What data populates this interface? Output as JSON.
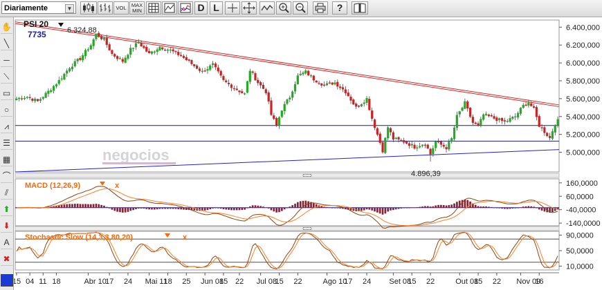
{
  "toolbar": {
    "period": "Diariamente",
    "vol_label": "VOL",
    "maxmin_label_1": "MAX",
    "maxmin_label_2": "MIN",
    "d_label": "D",
    "l_label": "L",
    "help_label": "?"
  },
  "icons": [
    "hand-icon",
    "line-icon",
    "hline-icon",
    "ray-icon",
    "rectangle-icon",
    "circle-icon",
    "fibonacci-icon",
    "fib-fan-icon",
    "fib-arc-icon",
    "channel-icon",
    "text-icon",
    "buy-arrow-icon",
    "sell-arrow-icon",
    "annotation-icon",
    "delete-icon"
  ],
  "colors": {
    "bull": "#22aa22",
    "bear": "#cc2222",
    "resistance": "#dd2222",
    "support": "#2222cc",
    "macd_line": "#8b4513",
    "macd_signal": "#ff7f27",
    "macd_hist": "#882233",
    "stoch_k": "#8b4513",
    "stoch_d": "#ff7f27",
    "title": "#ff6600"
  },
  "chart_data": [
    {
      "type": "candlestick",
      "title": "PSI 20",
      "last_value": "7735",
      "watermark": "negocios",
      "ylim": [
        4780,
        6480
      ],
      "y_ticks": [
        "6.400,000",
        "6.200,000",
        "6.000,000",
        "5.800,000",
        "5.600,000",
        "5.400,000",
        "5.200,000",
        "5.000,000"
      ],
      "y_tick_values": [
        6400,
        6200,
        6000,
        5800,
        5600,
        5400,
        5200,
        5000
      ],
      "x_labels": [
        "15",
        "04",
        "11",
        "18",
        "Abr 10",
        "17",
        "24",
        "Mai 11",
        "18",
        "25",
        "Jun 08",
        "15",
        "22",
        "Jul 08",
        "15",
        "22",
        "Ago 10",
        "17",
        "24",
        "Set 08",
        "15",
        "22",
        "Out 08",
        "15",
        "22",
        "Nov 09",
        "16"
      ],
      "x_label_bars": [
        0,
        5,
        10,
        15,
        27,
        35,
        42,
        50,
        57,
        64,
        71,
        78,
        84,
        92,
        99,
        106,
        117,
        125,
        132,
        142,
        149,
        156,
        167,
        174,
        181,
        190,
        197
      ],
      "n_bars": 205,
      "max_annotation": {
        "label": "6.324,88",
        "value": 6324.88,
        "bar": 30
      },
      "min_annotation": {
        "label": "4.896,39",
        "value": 4896.39,
        "bar": 156
      },
      "keypoints": [
        [
          0,
          5600
        ],
        [
          4,
          5620
        ],
        [
          8,
          5570
        ],
        [
          12,
          5680
        ],
        [
          16,
          5800
        ],
        [
          20,
          5950
        ],
        [
          24,
          6050
        ],
        [
          28,
          6200
        ],
        [
          30,
          6320
        ],
        [
          33,
          6260
        ],
        [
          36,
          6100
        ],
        [
          40,
          6020
        ],
        [
          43,
          6150
        ],
        [
          46,
          6230
        ],
        [
          50,
          6100
        ],
        [
          54,
          6180
        ],
        [
          58,
          6140
        ],
        [
          62,
          6080
        ],
        [
          66,
          5990
        ],
        [
          70,
          5900
        ],
        [
          74,
          5980
        ],
        [
          78,
          5800
        ],
        [
          82,
          5720
        ],
        [
          86,
          5650
        ],
        [
          88,
          5920
        ],
        [
          91,
          5780
        ],
        [
          94,
          5680
        ],
        [
          96,
          5420
        ],
        [
          98,
          5300
        ],
        [
          100,
          5480
        ],
        [
          103,
          5620
        ],
        [
          106,
          5850
        ],
        [
          109,
          5900
        ],
        [
          112,
          5820
        ],
        [
          116,
          5750
        ],
        [
          120,
          5780
        ],
        [
          124,
          5680
        ],
        [
          128,
          5500
        ],
        [
          132,
          5600
        ],
        [
          134,
          5380
        ],
        [
          136,
          5200
        ],
        [
          138,
          5020
        ],
        [
          140,
          5280
        ],
        [
          142,
          5150
        ],
        [
          146,
          5120
        ],
        [
          150,
          5060
        ],
        [
          154,
          5100
        ],
        [
          156,
          4980
        ],
        [
          158,
          5120
        ],
        [
          162,
          5050
        ],
        [
          164,
          5150
        ],
        [
          166,
          5400
        ],
        [
          169,
          5550
        ],
        [
          172,
          5330
        ],
        [
          174,
          5290
        ],
        [
          176,
          5420
        ],
        [
          180,
          5380
        ],
        [
          184,
          5340
        ],
        [
          188,
          5400
        ],
        [
          191,
          5520
        ],
        [
          193,
          5560
        ],
        [
          195,
          5480
        ],
        [
          197,
          5300
        ],
        [
          199,
          5230
        ],
        [
          201,
          5160
        ],
        [
          203,
          5320
        ],
        [
          205,
          5380
        ]
      ],
      "resistance": [
        [
          0,
          6460
        ],
        [
          205,
          5530
        ]
      ],
      "support": [
        [
          0,
          4780
        ],
        [
          205,
          5030
        ]
      ],
      "hlines": [
        5300,
        5125
      ]
    },
    {
      "type": "bar+line",
      "title": "MACD (12,26,9)",
      "ylim": [
        -160000,
        190000
      ],
      "y_ticks": [
        "160,0000",
        "60,0000",
        "-40,0000",
        "-140,0000"
      ],
      "y_tick_values": [
        160000,
        60000,
        -40000,
        -140000
      ],
      "zero_level": -25000
    },
    {
      "type": "line",
      "title": "Stochastic Slow (14,3,3,80,20)",
      "ylim": [
        0,
        100
      ],
      "y_ticks": [
        "90,0000",
        "50,0000",
        "10,0000"
      ],
      "y_tick_values": [
        90,
        50,
        10
      ],
      "levels": [
        80,
        20
      ]
    }
  ]
}
